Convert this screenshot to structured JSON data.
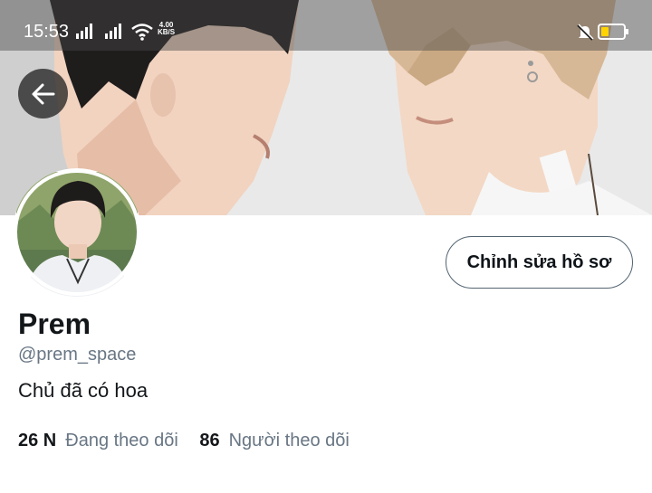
{
  "status_bar": {
    "time": "15:53",
    "speed_value": "4.00",
    "speed_unit": "KB/S",
    "icons": [
      "signal-icon",
      "signal-icon",
      "wifi-icon",
      "mute-icon",
      "battery-icon"
    ]
  },
  "profile": {
    "display_name": "Prem",
    "handle": "@prem_space",
    "bio": "Chủ đã có hoa",
    "edit_button_label": "Chỉnh sửa hồ sơ"
  },
  "stats": {
    "following_count": "26 N",
    "following_label": "Đang theo dõi",
    "followers_count": "86",
    "followers_label": "Người theo dõi"
  },
  "colors": {
    "secondary_text": "#687684",
    "primary_text": "#14171a",
    "battery_fill": "#ffd400"
  }
}
